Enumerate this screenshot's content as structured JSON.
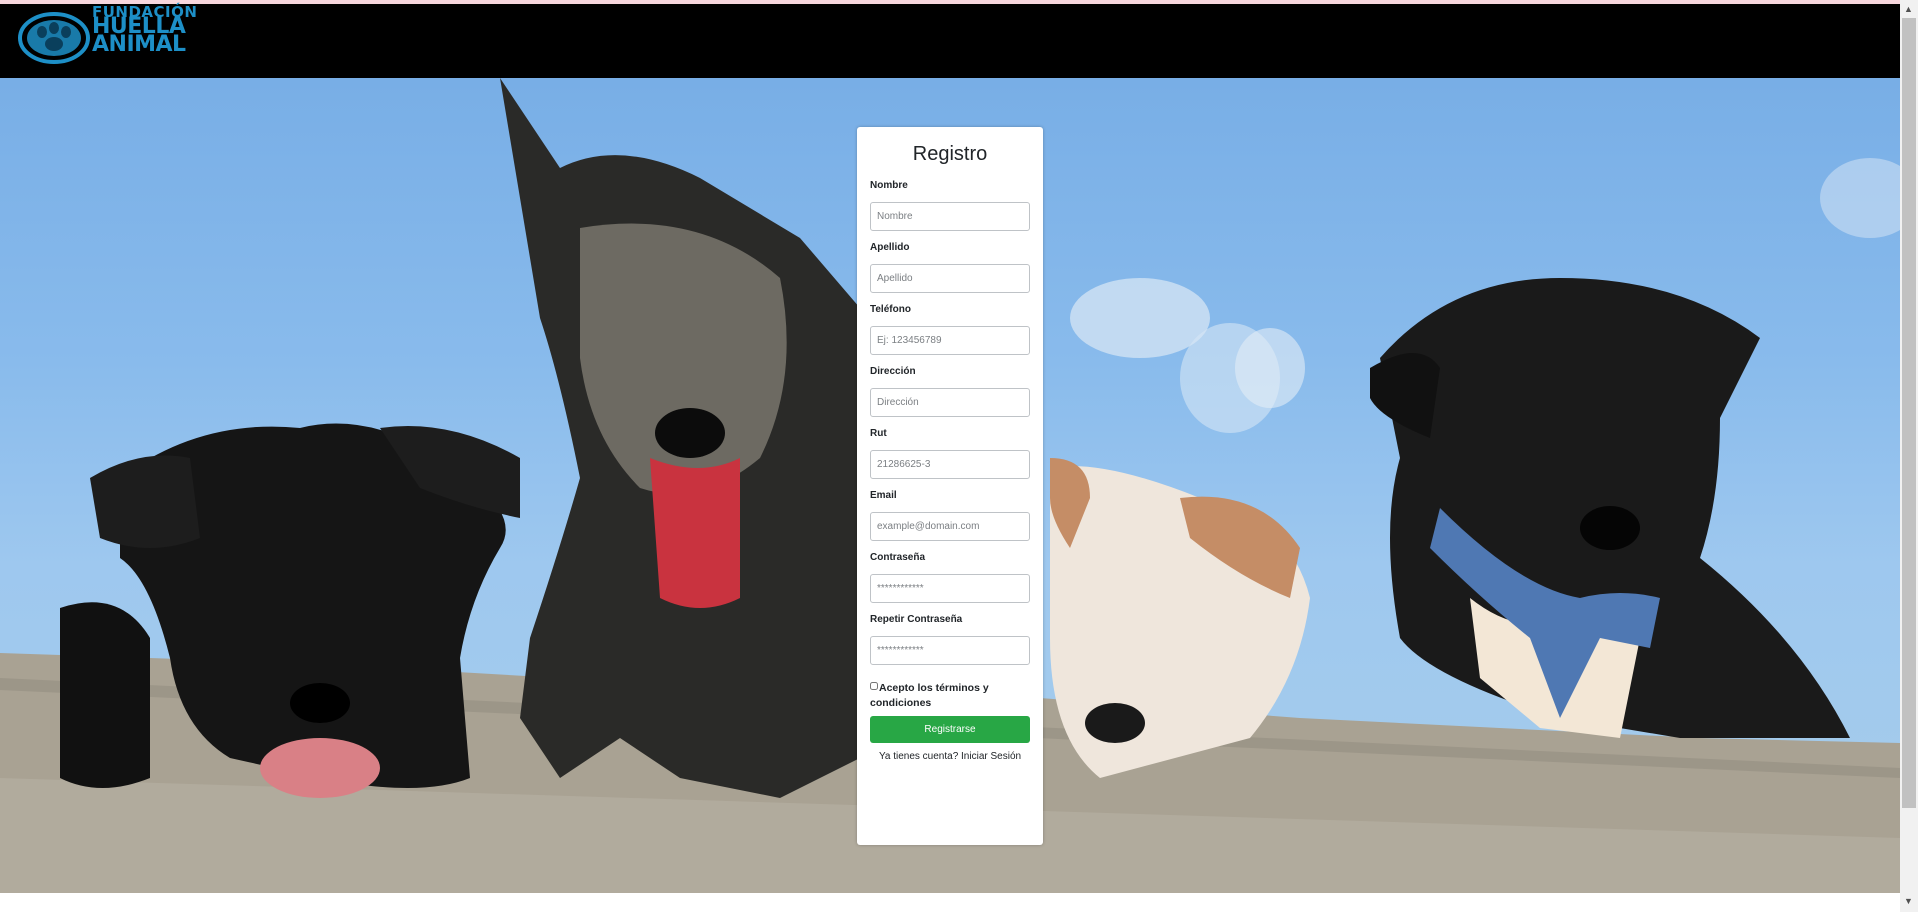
{
  "brand": {
    "line1": "FUNDACIÓN",
    "line2": "HUELLA",
    "line3": "ANIMAL",
    "color": "#1d8fc7"
  },
  "form": {
    "title": "Registro",
    "fields": [
      {
        "label": "Nombre",
        "placeholder": "Nombre"
      },
      {
        "label": "Apellido",
        "placeholder": "Apellido"
      },
      {
        "label": "Teléfono",
        "placeholder": "Ej: 123456789"
      },
      {
        "label": "Dirección",
        "placeholder": "Dirección"
      },
      {
        "label": "Rut",
        "placeholder": "21286625-3"
      },
      {
        "label": "Email",
        "placeholder": "example@domain.com"
      },
      {
        "label": "Contraseña",
        "placeholder": "************"
      },
      {
        "label": "Repetir Contraseña",
        "placeholder": "************"
      }
    ],
    "terms_label": "Acepto los términos y condiciones",
    "submit_label": "Registrarse",
    "login_prompt": "Ya tienes cuenta? Iniciar Sesión",
    "submit_color": "#28a745"
  },
  "hero": {
    "image_subject": "four-dogs-on-wall"
  },
  "icons": {
    "paw": "paw-icon",
    "scroll_up": "chevron-up-icon",
    "scroll_down": "chevron-down-icon"
  }
}
